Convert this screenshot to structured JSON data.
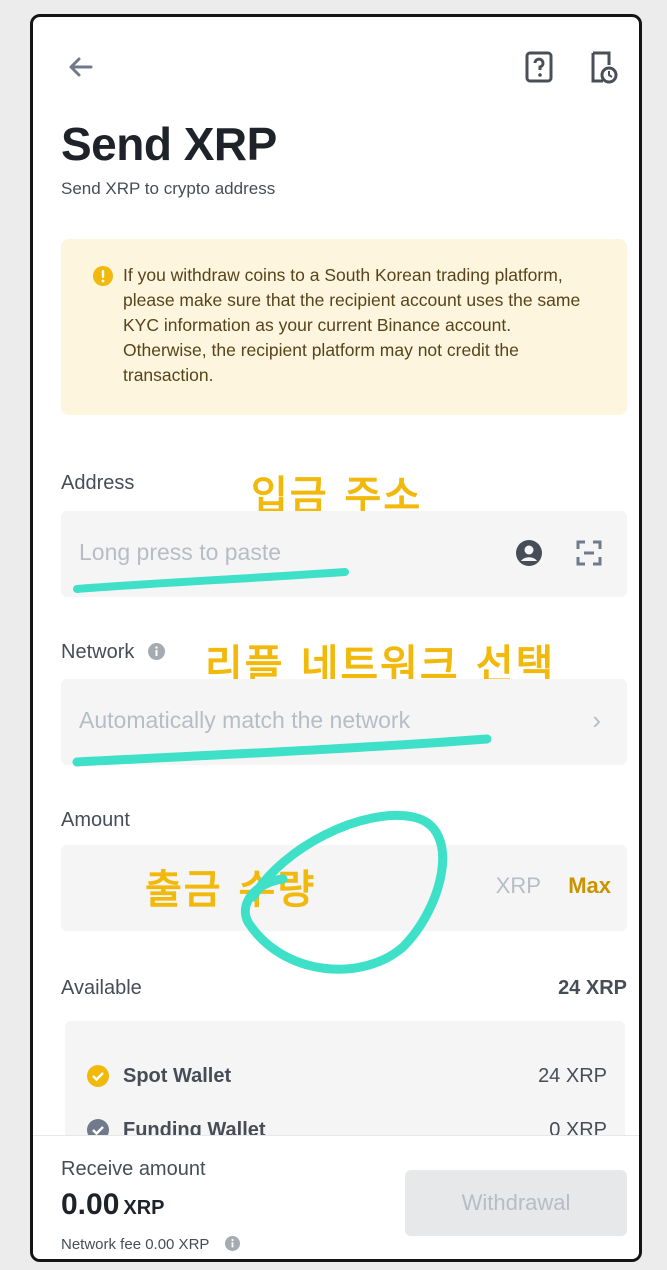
{
  "header": {
    "back_icon": "arrow-left-icon",
    "help_icon": "help-book-icon",
    "history_icon": "history-icon"
  },
  "page": {
    "title": "Send XRP",
    "subtitle": "Send XRP to crypto address"
  },
  "notice": {
    "icon": "alert-circle-icon",
    "text": "If you withdraw coins to a South Korean trading platform, please make sure that the recipient account uses the same KYC information as your current Binance account. Otherwise, the recipient platform may not credit the transaction."
  },
  "address": {
    "label": "Address",
    "placeholder": "Long press to paste",
    "annotation": "입금 주소"
  },
  "network": {
    "label": "Network",
    "placeholder": "Automatically match the network",
    "annotation": "리플 네트워크 선택"
  },
  "amount": {
    "label": "Amount",
    "unit": "XRP",
    "max_label": "Max",
    "annotation": "출금 수량"
  },
  "available": {
    "label": "Available",
    "value": "24 XRP",
    "wallets": [
      {
        "name": "Spot Wallet",
        "value": "24 XRP",
        "checked": true
      },
      {
        "name": "Funding Wallet",
        "value": "0 XRP",
        "checked": false
      }
    ]
  },
  "footer": {
    "receive_label": "Receive amount",
    "receive_value": "0.00",
    "receive_unit": "XRP",
    "fee_text": "Network fee 0.00 XRP",
    "withdraw_label": "Withdrawal"
  },
  "colors": {
    "accent": "#f0b90b",
    "highlight": "#3ee0c8",
    "notice_bg": "#fdf5de"
  }
}
